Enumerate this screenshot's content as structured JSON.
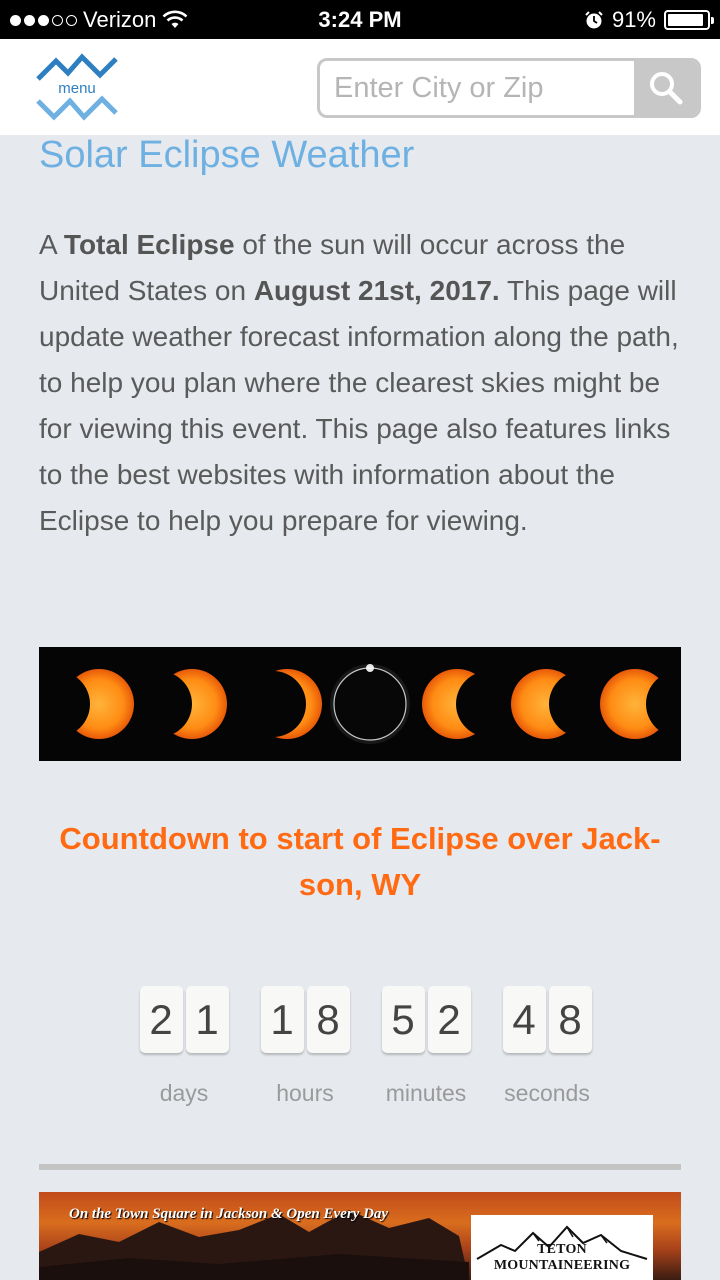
{
  "status_bar": {
    "carrier": "Verizon",
    "time": "3:24 PM",
    "battery": "91%",
    "battery_level": 0.91,
    "signal_bars": 3,
    "signal_total": 5
  },
  "header": {
    "menu_label": "menu",
    "search_placeholder": "Enter City or Zip",
    "search_value": ""
  },
  "page": {
    "title": "Solar Eclipse Weather",
    "intro": {
      "p1": "A ",
      "b1": "Total Eclipse",
      "p2": " of the sun will occur across the United States on ",
      "b2": "August 21st, 2017.",
      "p3": " This page will update weather forecast information along the path, to help you plan where the clearest skies might be for viewing this event. This page also features links to the best websites with information about the Eclipse to help you prepare for viewing."
    },
    "countdown_title": "Countdown to start of Eclipse over Jack-son, WY"
  },
  "countdown": [
    {
      "digits": [
        "2",
        "1"
      ],
      "label": "days"
    },
    {
      "digits": [
        "1",
        "8"
      ],
      "label": "hours"
    },
    {
      "digits": [
        "5",
        "2"
      ],
      "label": "minutes"
    },
    {
      "digits": [
        "4",
        "8"
      ],
      "label": "seconds"
    }
  ],
  "ad": {
    "tagline": "On the Town Square in Jackson & Open Every Day",
    "logo_text": "TETON MOUNTAINEERING"
  },
  "colors": {
    "title": "#6fb0e2",
    "countdown": "#ff6a13",
    "logo": "#2e7fc1"
  }
}
